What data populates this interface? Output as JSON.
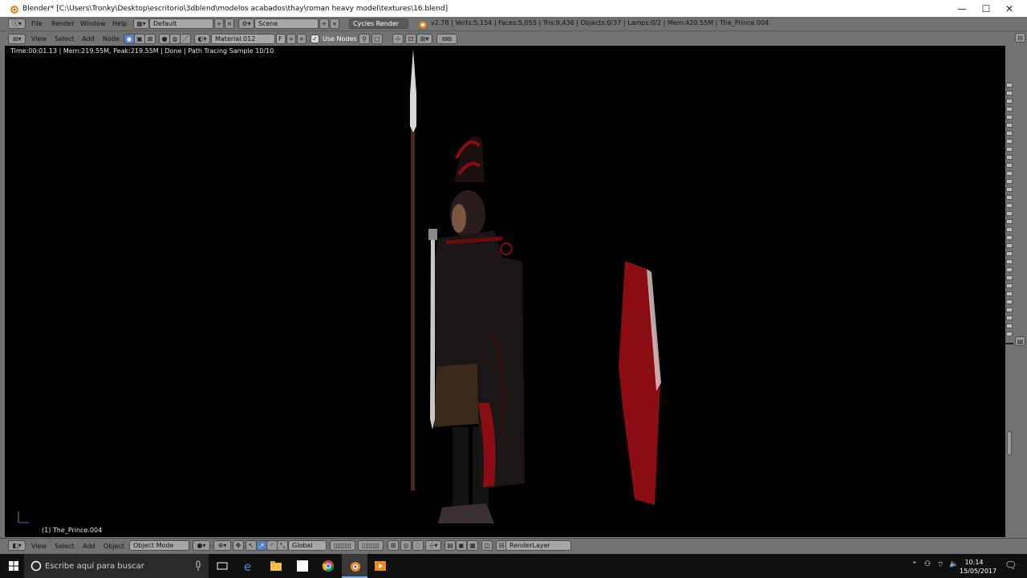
{
  "window": {
    "title": "Blender* [C:\\Users\\Tronky\\Desktop\\escritorio\\3dblend\\modelos acabados\\thay\\roman heavy model\\textures\\16.blend]",
    "minimize": "—",
    "maximize": "☐",
    "close": "✕"
  },
  "info_header": {
    "menus": [
      "File",
      "Render",
      "Window",
      "Help"
    ],
    "layout": "Default",
    "scene": "Scene",
    "engine": "Cycles Render",
    "stats": "v2.78 | Verts:5,154 | Faces:5,055 | Tris:9,436 | Objects:0/37 | Lamps:0/2 | Mem:420.55M | The_Prince.004"
  },
  "node_header": {
    "menus": [
      "View",
      "Select",
      "Add",
      "Node"
    ],
    "material": "Material.012",
    "material_fake": "F",
    "use_nodes_label": "Use Nodes"
  },
  "viewport": {
    "render_info": "Time:00:01.13 | Mem:219.55M, Peak:219.55M | Done | Path Tracing Sample 10/10",
    "object_name": "(1) The_Prince.004"
  },
  "view3d_header": {
    "menus": [
      "View",
      "Select",
      "Add",
      "Object"
    ],
    "mode": "Object Mode",
    "orientation": "Global",
    "render_layer": "RenderLayer"
  },
  "taskbar": {
    "search_placeholder": "Escribe aquí para buscar",
    "time": "10:14",
    "date": "15/05/2017"
  },
  "colors": {
    "blender_gray": "#727272",
    "viewport_bg": "#000000",
    "accent_blue": "#5680c2",
    "shield_red": "#8a0d14"
  }
}
